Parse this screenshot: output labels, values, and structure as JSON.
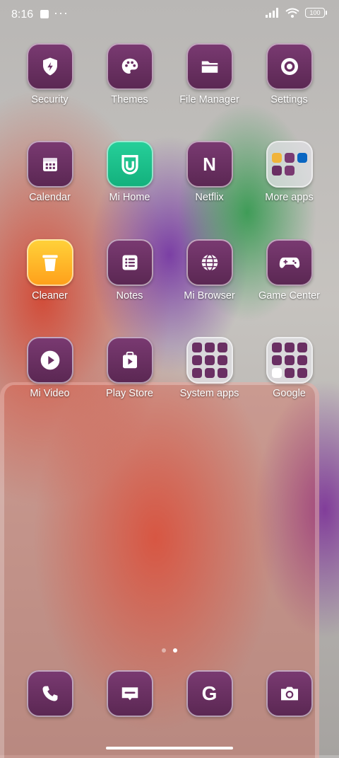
{
  "status": {
    "time": "8:16",
    "battery": "100"
  },
  "apps": [
    {
      "label": "Security",
      "icon": "shield-icon"
    },
    {
      "label": "Themes",
      "icon": "palette-icon"
    },
    {
      "label": "File Manager",
      "icon": "folder-icon"
    },
    {
      "label": "Settings",
      "icon": "gear-icon"
    },
    {
      "label": "Calendar",
      "icon": "calendar-icon"
    },
    {
      "label": "Mi Home",
      "icon": "mi-home-icon"
    },
    {
      "label": "Netflix",
      "icon": "netflix-icon"
    },
    {
      "label": "More apps",
      "icon": "folder-preview-icon"
    },
    {
      "label": "Cleaner",
      "icon": "trash-icon"
    },
    {
      "label": "Notes",
      "icon": "notes-icon"
    },
    {
      "label": "Mi Browser",
      "icon": "globe-icon"
    },
    {
      "label": "Game Center",
      "icon": "gamepad-icon"
    },
    {
      "label": "Mi Video",
      "icon": "play-icon"
    },
    {
      "label": "Play Store",
      "icon": "play-store-icon"
    },
    {
      "label": "System apps",
      "icon": "folder-preview-icon"
    },
    {
      "label": "Google",
      "icon": "folder-preview-icon"
    }
  ],
  "dock": [
    {
      "icon": "phone-icon"
    },
    {
      "icon": "messages-icon"
    },
    {
      "icon": "google-g-icon"
    },
    {
      "icon": "camera-icon"
    }
  ],
  "pager": {
    "pages": 2,
    "active": 2
  },
  "colors": {
    "tile": "#6a2f63",
    "mi_home": "#1ec28a",
    "cleaner": "#ffb52a"
  }
}
